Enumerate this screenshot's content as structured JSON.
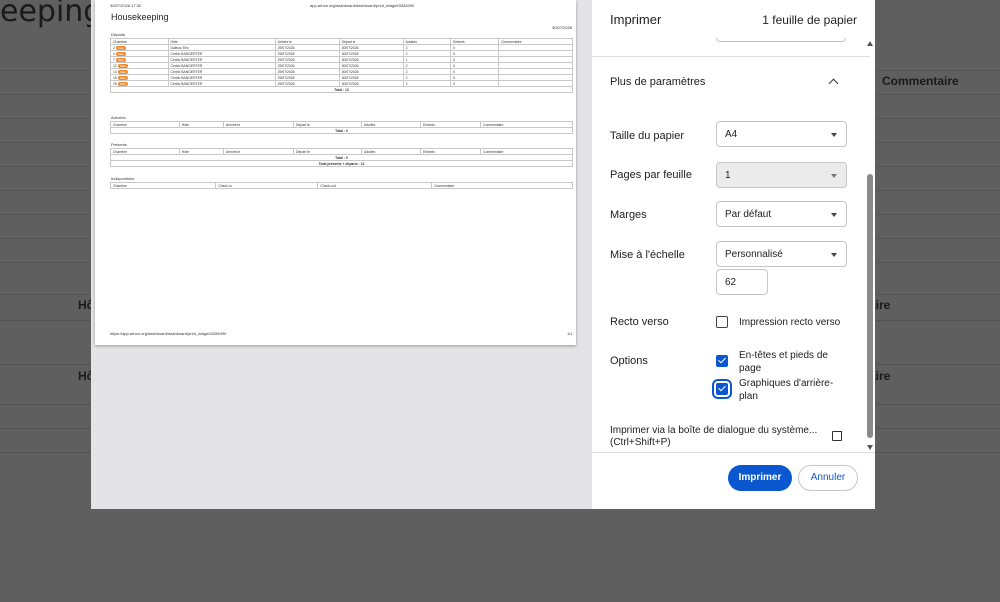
{
  "background": {
    "title": "eeping",
    "labels": {
      "commentaire": "Commentaire",
      "hote_1": "Hô",
      "hote_2": "Hô",
      "aire_1": "aire",
      "aire_2": "aire"
    }
  },
  "dialog": {
    "title": "Imprimer",
    "sheet_count": "1 feuille de papier",
    "more_settings": "Plus de paramètres",
    "paper_size": {
      "label": "Taille du papier",
      "value": "A4"
    },
    "pages_per_sheet": {
      "label": "Pages par feuille",
      "value": "1"
    },
    "margins": {
      "label": "Marges",
      "value": "Par défaut"
    },
    "scale": {
      "label": "Mise à l'échelle",
      "value": "Personnalisé",
      "custom": "62"
    },
    "duplex": {
      "label": "Recto verso",
      "option": "Impression recto verso",
      "checked": false
    },
    "options": {
      "label": "Options",
      "headers_footers": {
        "label": "En-têtes et pieds de page",
        "checked": true
      },
      "background_graphics": {
        "label": "Graphiques d'arrière-plan",
        "checked": true
      }
    },
    "system_dialog": "Imprimer via la boîte de dialogue du système... (Ctrl+Shift+P)",
    "print_button": "Imprimer",
    "cancel_button": "Annuler"
  },
  "preview": {
    "header_left": "30/07/2026 17:32",
    "header_center": "app.arhon.org/dashboard/dashboard/print_widget/3284090",
    "page_title": "Housekeeping",
    "page_date": "30/07/2026",
    "footer_url": "https://app.arhon.org/dashboard/dashboard/print_widget/3284090",
    "footer_page": "1/1",
    "sections": {
      "departs": {
        "title": "Départs",
        "headers": [
          "Chambre",
          "Hôte",
          "Arrivée le",
          "Départ le",
          "Adultes",
          "Enfants",
          "Commentaire"
        ],
        "rows": [
          [
            "2",
            "Sale",
            "Dalinou Eric",
            "29/07/2026",
            "30/07/2026",
            "2",
            "0"
          ],
          [
            "4",
            "Sale",
            "Cédric BANGERTER",
            "29/07/2026",
            "30/07/2026",
            "2",
            "0"
          ],
          [
            "7",
            "Sale",
            "Cédric BANGERTER",
            "29/07/2026",
            "30/07/2026",
            "1",
            "0"
          ],
          [
            "12",
            "Sale",
            "Cédric BANGERTER",
            "29/07/2026",
            "30/07/2026",
            "2",
            "0"
          ],
          [
            "14",
            "Sale",
            "Cédric BANGERTER",
            "29/07/2026",
            "30/07/2026",
            "2",
            "0"
          ],
          [
            "15",
            "Sale",
            "Cédric BANGERTER",
            "29/07/2026",
            "30/07/2026",
            "2",
            "0"
          ],
          [
            "25",
            "Sale",
            "Cédric BANGERTER",
            "29/07/2026",
            "30/07/2026",
            "2",
            "0"
          ]
        ],
        "total": "Total : 13"
      },
      "arrivees": {
        "title": "Arrivées",
        "headers": [
          "Chambre",
          "Hôte",
          "Arrivée le",
          "Départ le",
          "Adultes",
          "Enfants",
          "Commentaire"
        ],
        "total": "Total : 0"
      },
      "presents": {
        "title": "Présents",
        "headers": [
          "Chambre",
          "Hôte",
          "Arrivée le",
          "Départ le",
          "Adultes",
          "Enfants",
          "Commentaire"
        ],
        "total": "Total : 0",
        "grand_total": "Total présents + départs : 13"
      },
      "indisponibles": {
        "title": "Indisponibles",
        "headers": [
          "Chambre",
          "Check-in",
          "Check-out",
          "Commentaire"
        ]
      }
    }
  },
  "colors": {
    "accent": "#0b57d0",
    "pill": "#f08a2c",
    "overlay": "#5f5f5f"
  }
}
